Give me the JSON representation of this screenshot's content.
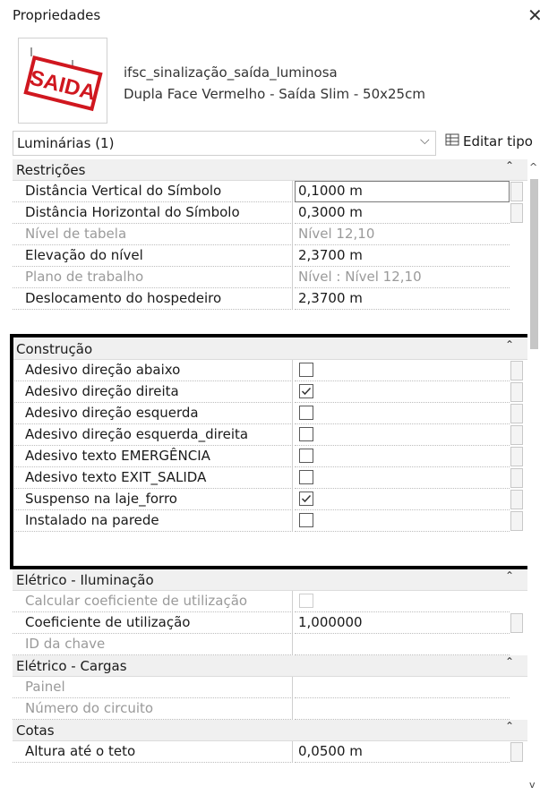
{
  "panel": {
    "title": "Propriedades",
    "close_glyph": "✕"
  },
  "type_selector": {
    "family_name": "ifsc_sinalização_saída_luminosa",
    "type_name": "Dupla Face Vermelho - Saída Slim - 50x25cm",
    "thumbnail_text": "SAIDA"
  },
  "instance_filter": {
    "label": "Luminárias (1)",
    "edit_type_label": "Editar tipo"
  },
  "categories": {
    "restricoes": "Restrições",
    "construcao": "Construção",
    "eletrico_iluminacao": "Elétrico - Iluminação",
    "eletrico_cargas": "Elétrico - Cargas",
    "cotas": "Cotas"
  },
  "restricoes_rows": [
    {
      "name": "Distância Vertical do Símbolo",
      "value": "0,1000 m"
    },
    {
      "name": "Distância Horizontal do Símbolo",
      "value": "0,3000 m"
    },
    {
      "name": "Nível de tabela",
      "value": "Nível 12,10"
    },
    {
      "name": "Elevação do nível",
      "value": "2,3700 m"
    },
    {
      "name": "Plano de trabalho",
      "value": "Nível : Nível 12,10"
    },
    {
      "name": "Deslocamento do hospedeiro",
      "value": "2,3700 m"
    }
  ],
  "construcao_rows": [
    {
      "name": "Adesivo direção abaixo",
      "checked": false
    },
    {
      "name": "Adesivo direção direita",
      "checked": true
    },
    {
      "name": "Adesivo direção esquerda",
      "checked": false
    },
    {
      "name": "Adesivo direção esquerda_direita",
      "checked": false
    },
    {
      "name": "Adesivo texto EMERGÊNCIA",
      "checked": false
    },
    {
      "name": "Adesivo texto EXIT_SALIDA",
      "checked": false
    },
    {
      "name": "Suspenso na laje_forro",
      "checked": true
    },
    {
      "name": "Instalado na parede",
      "checked": false
    }
  ],
  "eletrico_iluminacao_rows": [
    {
      "name": "Calcular coeficiente de utilização",
      "checked": false
    },
    {
      "name": "Coeficiente de utilização",
      "value": "1,000000"
    },
    {
      "name": "ID da chave",
      "value": ""
    }
  ],
  "eletrico_cargas_rows": [
    {
      "name": "Painel",
      "value": ""
    },
    {
      "name": "Número do circuito",
      "value": ""
    }
  ],
  "cotas_rows": [
    {
      "name": "Altura até o teto",
      "value": "0,0500 m"
    }
  ],
  "icons": {
    "close": "close-icon",
    "collapse": "chevron-up-icon",
    "dropdown": "chevron-down-icon",
    "edit_type": "edit-type-icon",
    "checkbox_check": "check-icon"
  },
  "colors": {
    "thumbnail_red": "#d0171f",
    "highlight_border": "#000000",
    "category_bg": "#f0f0f0"
  }
}
